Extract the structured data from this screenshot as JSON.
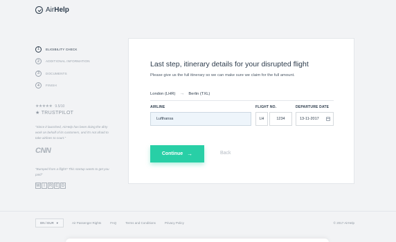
{
  "brand": {
    "name_light": "Air",
    "name_bold": "Help"
  },
  "steps": [
    {
      "num": "1",
      "label": "ELIGIBILITY CHECK"
    },
    {
      "num": "2",
      "label": "ADDITIONAL INFORMATION"
    },
    {
      "num": "3",
      "label": "DOCUMENTS"
    },
    {
      "num": "4",
      "label": "FINISH"
    }
  ],
  "rating": {
    "stars": "★★★★★",
    "score": "9.5/10",
    "provider": "TRUSTPILOT"
  },
  "testimonials": [
    {
      "quote": "\"Since it launched, AirHelp has been doing the dirty work on behalf of its customers, and it's not afraid to take airlines to court.\"",
      "source": "CNN"
    },
    {
      "quote": "\"Bumped from a flight? This startup wants to get you paid\"",
      "source": "WIRED"
    }
  ],
  "form": {
    "title": "Last step, itinerary details for your disrupted flight",
    "subtitle": "Please give us the full itinerary so we can make sure we claim for the full amount.",
    "route_from": "London (LHR)",
    "route_to": "Berlin (TXL)",
    "airline_label": "AIRLINE",
    "airline_value": "Lufthansa",
    "flight_label": "FLIGHT NO.",
    "flight_prefix": "LH",
    "flight_number": "1234",
    "date_label": "DEPARTURE DATE",
    "date_value": "13-11-2017",
    "continue_label": "Continue",
    "back_label": "Back"
  },
  "footer": {
    "language": "EN / EUR",
    "links": [
      "Air Passenger Rights",
      "FAQ",
      "Terms and Conditions",
      "Privacy Policy"
    ],
    "copyright": "© 2017 AirHelp"
  },
  "colors": {
    "accent": "#28cfa6",
    "text": "#2b3a4a",
    "background": "#f2f3f5"
  }
}
